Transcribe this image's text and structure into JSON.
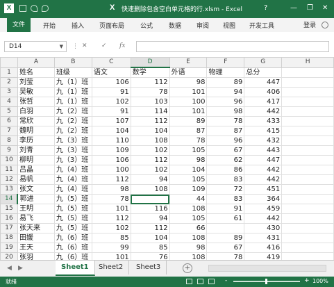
{
  "titlebar": {
    "title": "快速删除包含空白单元格的行.xlsm - Excel",
    "help": "?",
    "min": "—",
    "restore": "❐",
    "close": "✕"
  },
  "ribbon": {
    "tabs": [
      "文件",
      "开始",
      "插入",
      "页面布局",
      "公式",
      "数据",
      "审阅",
      "视图",
      "开发工具"
    ],
    "account": "登录"
  },
  "formula_bar": {
    "name_box": "D14",
    "cancel": "✕",
    "enter": "✓",
    "fx": "fx",
    "content": ""
  },
  "columns": [
    "A",
    "B",
    "C",
    "D",
    "E",
    "F",
    "G",
    "H"
  ],
  "rows": [
    [
      "姓名",
      "班级",
      "语文",
      "数学",
      "外语",
      "物理",
      "总分",
      ""
    ],
    [
      "刘莹",
      "九（1）班",
      "106",
      "112",
      "98",
      "89",
      "447",
      ""
    ],
    [
      "吴敏",
      "九（1）班",
      "91",
      "78",
      "101",
      "94",
      "406",
      ""
    ],
    [
      "张哲",
      "九（1）班",
      "102",
      "103",
      "100",
      "96",
      "417",
      ""
    ],
    [
      "白羽",
      "九（2）班",
      "91",
      "114",
      "101",
      "98",
      "442",
      ""
    ],
    [
      "常欣",
      "九（2）班",
      "107",
      "112",
      "89",
      "78",
      "433",
      ""
    ],
    [
      "魏明",
      "九（2）班",
      "104",
      "104",
      "87",
      "87",
      "415",
      ""
    ],
    [
      "李历",
      "九（3）班",
      "110",
      "108",
      "78",
      "96",
      "432",
      ""
    ],
    [
      "刘青",
      "九（3）班",
      "109",
      "102",
      "105",
      "67",
      "443",
      ""
    ],
    [
      "柳明",
      "九（3）班",
      "106",
      "112",
      "98",
      "62",
      "447",
      ""
    ],
    [
      "吕晶",
      "九（4）班",
      "100",
      "102",
      "104",
      "86",
      "442",
      ""
    ],
    [
      "易帆",
      "九（4）班",
      "112",
      "94",
      "105",
      "83",
      "442",
      ""
    ],
    [
      "张文",
      "九（4）班",
      "98",
      "108",
      "109",
      "72",
      "451",
      ""
    ],
    [
      "郭进",
      "九（5）班",
      "78",
      "",
      "44",
      "83",
      "364",
      ""
    ],
    [
      "王明",
      "九（5）班",
      "101",
      "116",
      "108",
      "91",
      "459",
      ""
    ],
    [
      "易飞",
      "九（5）班",
      "112",
      "94",
      "105",
      "61",
      "442",
      ""
    ],
    [
      "张天来",
      "九（5）班",
      "102",
      "112",
      "66",
      "",
      "430",
      ""
    ],
    [
      "田媛",
      "九（6）班",
      "85",
      "104",
      "108",
      "89",
      "431",
      ""
    ],
    [
      "王天",
      "九（6）班",
      "99",
      "85",
      "98",
      "67",
      "416",
      ""
    ],
    [
      "张羽",
      "九（6）班",
      "101",
      "76",
      "108",
      "78",
      "419",
      ""
    ]
  ],
  "selected": {
    "row": 14,
    "col": "D"
  },
  "sheets": [
    "Sheet1",
    "Sheet2",
    "Sheet3"
  ],
  "active_sheet": "Sheet1",
  "sheet_nav": {
    "prev": "◀",
    "next": "▶",
    "add": "+"
  },
  "status": {
    "ready": "就绪",
    "zoom_minus": "-",
    "zoom_plus": "+",
    "zoom": "100%"
  },
  "colors": {
    "accent": "#217346",
    "header_bg": "#f2f2f2",
    "grid": "#e0e0e0"
  },
  "icons": {
    "save": "save-icon",
    "undo": "undo-icon",
    "redo": "redo-icon",
    "excel": "excel-logo-icon"
  }
}
